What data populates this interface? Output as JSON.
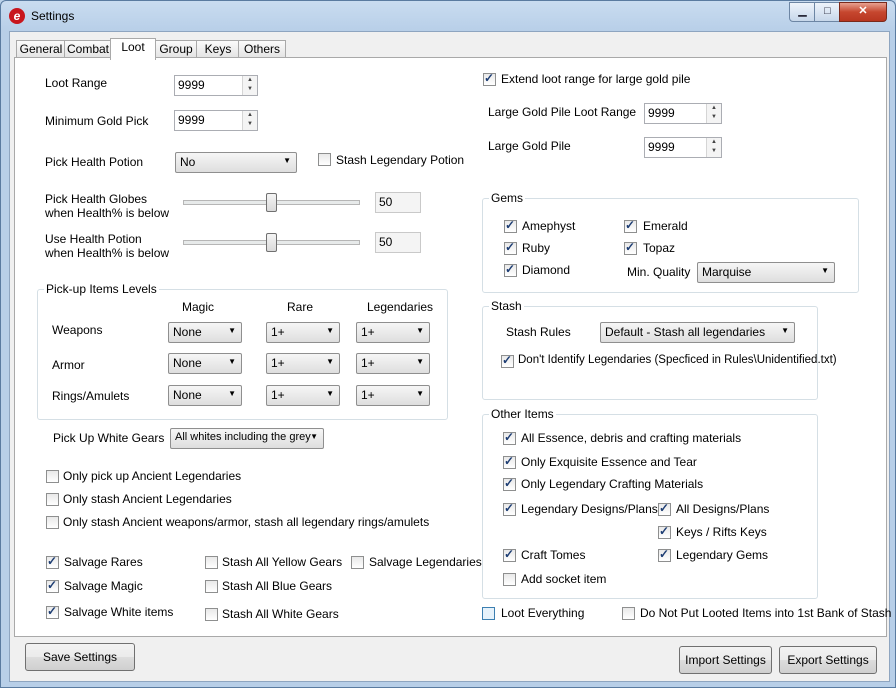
{
  "window": {
    "title": "Settings"
  },
  "tabs": [
    "General",
    "Combat",
    "Loot",
    "Group",
    "Keys",
    "Others"
  ],
  "loot": {
    "loot_range_label": "Loot Range",
    "loot_range_value": "9999",
    "min_gold_label": "Minimum Gold Pick",
    "min_gold_value": "9999",
    "pick_potion_label": "Pick Health Potion",
    "pick_potion_value": "No",
    "stash_legendary_potion": "Stash Legendary Potion",
    "globes_label_1": "Pick Health Globes",
    "globes_label_2": "when Health% is below",
    "globes_value": "50",
    "globes_level": 0.5,
    "usepot_label_1": "Use Health Potion",
    "usepot_label_2": "when Health% is below",
    "usepot_value": "50",
    "usepot_level": 0.5,
    "extend_range": "Extend loot range for large gold pile",
    "large_range_label": "Large Gold Pile Loot Range",
    "large_range_value": "9999",
    "large_pile_label": "Large Gold Pile",
    "large_pile_value": "9999"
  },
  "pickup_levels": {
    "title": "Pick-up Items Levels",
    "columns": [
      "Magic",
      "Rare",
      "Legendaries"
    ],
    "rows": [
      {
        "label": "Weapons",
        "values": [
          "None",
          "1+",
          "1+"
        ]
      },
      {
        "label": "Armor",
        "values": [
          "None",
          "1+",
          "1+"
        ]
      },
      {
        "label": "Rings/Amulets",
        "values": [
          "None",
          "1+",
          "1+"
        ]
      }
    ]
  },
  "white_gears": {
    "label": "Pick Up White Gears",
    "value": "All whites including the grey"
  },
  "ancient": [
    "Only pick up Ancient Legendaries",
    "Only stash Ancient Legendaries",
    "Only stash Ancient weapons/armor, stash all legendary rings/amulets"
  ],
  "salvage": {
    "salvage_rares": "Salvage Rares",
    "salvage_magic": "Salvage Magic",
    "salvage_white": "Salvage White items",
    "stash_yellow": "Stash All Yellow Gears",
    "stash_blue": "Stash All Blue Gears",
    "stash_white": "Stash All White Gears",
    "salvage_legendaries": "Salvage Legendaries"
  },
  "gems": {
    "title": "Gems",
    "amethyst": "Amephyst",
    "ruby": "Ruby",
    "diamond": "Diamond",
    "emerald": "Emerald",
    "topaz": "Topaz",
    "quality_label": "Min. Quality",
    "quality_value": "Marquise"
  },
  "stash": {
    "title": "Stash",
    "rules_label": "Stash Rules",
    "rules_value": "Default - Stash all legendaries",
    "dont_identify": "Don't Identify Legendaries (Specficed in Rules\\Unidentified.txt)"
  },
  "other_items": {
    "title": "Other Items",
    "essence": "All Essence, debris and crafting materials",
    "exquisite": "Only Exquisite Essence and Tear",
    "legendary_crafting": "Only Legendary Crafting Materials",
    "legendary_designs": "Legendary Designs/Plans",
    "all_designs": "All Designs/Plans",
    "keys_rifts": "Keys / Rifts Keys",
    "craft_tomes": "Craft Tomes",
    "legendary_gems": "Legendary Gems",
    "add_socket": "Add socket item"
  },
  "bottom": {
    "loot_everything": "Loot Everything",
    "dont_put": "Do Not Put Looted Items into 1st Bank of Stash",
    "save": "Save Settings",
    "import": "Import Settings",
    "export": "Export Settings"
  }
}
